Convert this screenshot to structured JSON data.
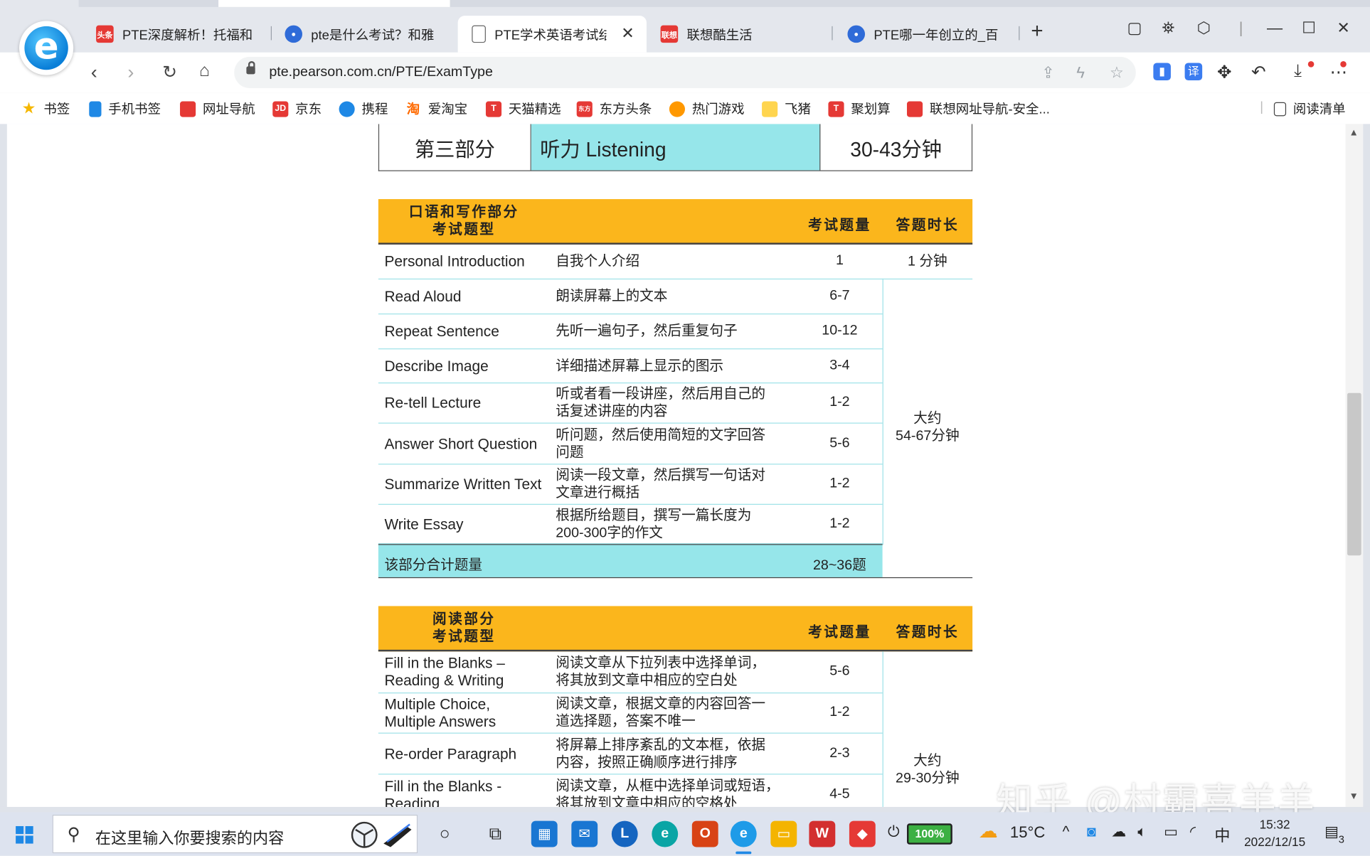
{
  "browser": {
    "tabs": [
      {
        "title": "PTE深度解析！托福和",
        "favicon": "toutiao-icon",
        "badge": "头条"
      },
      {
        "title": "pte是什么考试？和雅",
        "favicon": "baidu-paw-icon"
      },
      {
        "title": "PTE学术英语考试结",
        "favicon": "document-icon",
        "active": true
      },
      {
        "title": "联想酷生活",
        "favicon": "lenovo-icon",
        "badge": "联想"
      },
      {
        "title": "PTE哪一年创立的_百度",
        "favicon": "baidu-paw-icon"
      }
    ],
    "close_glyph": "✕",
    "newtab_glyph": "+",
    "url": "pte.pearson.com.cn/PTE/ExamType",
    "bookmarks": [
      {
        "label": "书签",
        "icon": "star-icon"
      },
      {
        "label": "手机书签",
        "icon": "phone-icon"
      },
      {
        "label": "网址导航",
        "icon": "lenovo-icon"
      },
      {
        "label": "京东",
        "icon": "jd-icon",
        "badge": "JD"
      },
      {
        "label": "携程",
        "icon": "ctrip-icon"
      },
      {
        "label": "爱淘宝",
        "icon": "taobao-icon",
        "badge": "淘"
      },
      {
        "label": "天猫精选",
        "icon": "tmall-icon",
        "badge": "T"
      },
      {
        "label": "东方头条",
        "icon": "dongfang-icon",
        "badge": "东方"
      },
      {
        "label": "热门游戏",
        "icon": "game-icon"
      },
      {
        "label": "飞猪",
        "icon": "fliggy-icon"
      },
      {
        "label": "聚划算",
        "icon": "juhuasuan-icon",
        "badge": "T"
      },
      {
        "label": "联想网址导航-安全...",
        "icon": "lenovo-icon"
      }
    ],
    "reading_list": "阅读清单"
  },
  "page": {
    "section_row": {
      "part": "第三部分",
      "name": "听力 Listening",
      "time": "30-43分钟"
    },
    "speaking": {
      "header_line1": "口语和写作部分",
      "header_line2": "考试题型",
      "col_count": "考试题量",
      "col_time": "答题时长",
      "rows": [
        {
          "en": [
            "Personal Introduction"
          ],
          "cn": [
            "自我个人介绍"
          ],
          "count": "1"
        },
        {
          "en": [
            "Read Aloud"
          ],
          "cn": [
            "朗读屏幕上的文本"
          ],
          "count": "6-7"
        },
        {
          "en": [
            "Repeat Sentence"
          ],
          "cn": [
            "先听一遍句子，然后重复句子"
          ],
          "count": "10-12"
        },
        {
          "en": [
            "Describe Image"
          ],
          "cn": [
            "详细描述屏幕上显示的图示"
          ],
          "count": "3-4"
        },
        {
          "en": [
            "Re-tell Lecture"
          ],
          "cn": [
            "听或者看一段讲座，然后用自己的",
            "话复述讲座的内容"
          ],
          "count": "1-2"
        },
        {
          "en": [
            "Answer Short Question"
          ],
          "cn": [
            "听问题，然后使用简短的文字回答",
            "问题"
          ],
          "count": "5-6"
        },
        {
          "en": [
            "Summarize Written Text"
          ],
          "cn": [
            "阅读一段文章，然后撰写一句话对",
            "文章进行概括"
          ],
          "count": "1-2"
        },
        {
          "en": [
            "Write Essay"
          ],
          "cn": [
            "根据所给题目，撰写一篇长度为",
            "200-300字的作文"
          ],
          "count": "1-2"
        }
      ],
      "intro_time": "1 分钟",
      "time_line1": "大约",
      "time_line2": "54-67分钟",
      "total_label": "该部分合计题量",
      "total_value": "28~36题"
    },
    "reading": {
      "header_line1": "阅读部分",
      "header_line2": "考试题型",
      "col_count": "考试题量",
      "col_time": "答题时长",
      "rows": [
        {
          "en": [
            "Fill in the Blanks –",
            "Reading & Writing"
          ],
          "cn": [
            "阅读文章从下拉列表中选择单词，",
            "将其放到文章中相应的空白处"
          ],
          "count": "5-6"
        },
        {
          "en": [
            "Multiple Choice,",
            "Multiple Answers"
          ],
          "cn": [
            "阅读文章，根据文章的内容回答一",
            "道选择题，答案不唯一"
          ],
          "count": "1-2"
        },
        {
          "en": [
            "Re-order Paragraph"
          ],
          "cn": [
            "将屏幕上排序紊乱的文本框，依据",
            "内容，按照正确顺序进行排序"
          ],
          "count": "2-3"
        },
        {
          "en": [
            "Fill in the Blanks -",
            "Reading"
          ],
          "cn": [
            "阅读文章，从框中选择单词或短语，",
            "将其放到文章中相应的空格处"
          ],
          "count": "4-5"
        }
      ],
      "time_line1": "大约",
      "time_line2": "29-30分钟"
    },
    "watermark": "知乎 @村霸喜羊羊"
  },
  "taskbar": {
    "search_placeholder": "在这里输入你要搜索的内容",
    "battery": "100%",
    "temperature": "15°C",
    "ime": "中",
    "time": "15:32",
    "date": "2022/12/15",
    "notification_count": "3"
  },
  "colors": {
    "header_orange": "#fbb61c",
    "cyan_fill": "#96e6ea",
    "row_divider": "#9fe2e8"
  }
}
